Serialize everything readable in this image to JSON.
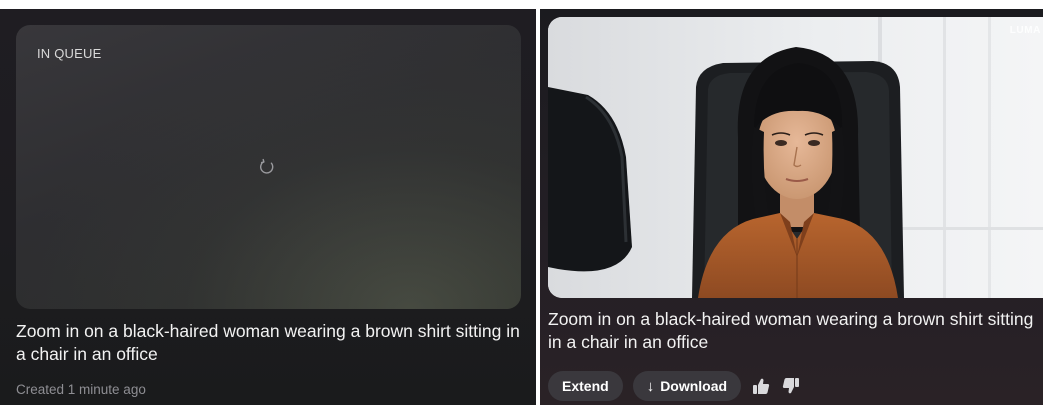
{
  "queued_item": {
    "status_label": "IN QUEUE",
    "prompt": "Zoom in on a black-haired woman wearing a brown shirt sitting in a chair in an office",
    "created": "Created 1 minute ago",
    "icon": "loading-spinner-icon"
  },
  "finished_item": {
    "watermark": "LUMA",
    "prompt": "Zoom in on a black-haired woman wearing a brown shirt sitting in a chair in an office",
    "actions": {
      "extend_label": "Extend",
      "download_label": "Download",
      "download_icon": "↓"
    },
    "feedback_icons": [
      "thumbs-up-icon",
      "thumbs-down-icon"
    ]
  },
  "colors": {
    "panel_bg": "#1d1c20",
    "card_bg": "#333236",
    "button_bg": "#3a383d",
    "text_primary": "#f2f2f2",
    "text_muted": "#8e8e93"
  }
}
